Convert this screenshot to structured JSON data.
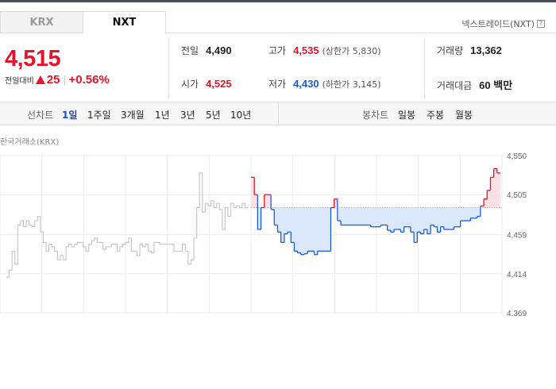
{
  "tabs": {
    "krx": "KRX",
    "nxt": "NXT"
  },
  "nxt_info": {
    "label": "넥스트레이드(NXT)",
    "help_icon": "?"
  },
  "price": {
    "current": "4,515",
    "change_label": "전일대비",
    "change_value": "25",
    "change_percent": "+0.56%",
    "direction_icon": "up-triangle-icon",
    "color": "#e5132b"
  },
  "stats": {
    "prev_close": {
      "label": "전일",
      "value": "4,490"
    },
    "high": {
      "label": "고가",
      "value": "4,535",
      "sub": "(상한가 5,830)"
    },
    "volume": {
      "label": "거래량",
      "value": "13,362"
    },
    "open": {
      "label": "시가",
      "value": "4,525"
    },
    "low": {
      "label": "저가",
      "value": "4,430",
      "sub": "(하한가 3,145)"
    },
    "amount": {
      "label": "거래대금",
      "value": "60 백만"
    }
  },
  "line_chart_menu": {
    "label": "선차트",
    "periods": [
      "1일",
      "1주일",
      "3개월",
      "1년",
      "3년",
      "5년",
      "10년"
    ],
    "active": "1일"
  },
  "candle_chart_menu": {
    "label": "봉차트",
    "periods": [
      "일봉",
      "주봉",
      "월봉"
    ]
  },
  "chart_data": {
    "type": "line",
    "title": "한국거래소(KRX)",
    "y_ticks": [
      "4,550",
      "4,505",
      "4,459",
      "4,414",
      "4,369"
    ],
    "ylim": [
      4369,
      4550
    ],
    "baseline": 4490,
    "colors": {
      "krx_line": "#c8c8c8",
      "up": "#e5132b",
      "down": "#1a5bd8",
      "down_fill": "#dbe8f9",
      "up_fill": "#fbe1e3"
    },
    "krx_series": [
      4410,
      4418,
      4440,
      4425,
      4470,
      4475,
      4468,
      4475,
      4470,
      4468,
      4475,
      4480,
      4462,
      4450,
      4440,
      4448,
      4445,
      4440,
      4430,
      4435,
      4430,
      4445,
      4448,
      4445,
      4448,
      4450,
      4450,
      4445,
      4440,
      4448,
      4452,
      4455,
      4450,
      4450,
      4442,
      4445,
      4445,
      4448,
      4448,
      4440,
      4445,
      4448,
      4450,
      4455,
      4440,
      4440,
      4435,
      4448,
      4445,
      4448,
      4440,
      4438,
      4450,
      4450,
      4448,
      4448,
      4448,
      4448,
      4448,
      4440,
      4440,
      4440,
      4448,
      4440,
      4425,
      4430,
      4455,
      4490,
      4530,
      4485,
      4495,
      4492,
      4498,
      4490,
      4495,
      4488,
      4465,
      4490,
      4480,
      4495,
      4490,
      4492,
      4490,
      4495,
      4490,
      4492
    ],
    "nxt_series": [
      4525,
      4505,
      4465,
      4490,
      4505,
      4505,
      4488,
      4470,
      4462,
      4450,
      4460,
      4462,
      4450,
      4440,
      4438,
      4436,
      4437,
      4440,
      4440,
      4436,
      4440,
      4440,
      4440,
      4440,
      4490,
      4500,
      4475,
      4470,
      4470,
      4470,
      4470,
      4470,
      4470,
      4470,
      4470,
      4470,
      4468,
      4468,
      4468,
      4470,
      4470,
      4464,
      4462,
      4465,
      4465,
      4462,
      4468,
      4468,
      4462,
      4450,
      4462,
      4460,
      4465,
      4460,
      4470,
      4468,
      4462,
      4468,
      4465,
      4465,
      4465,
      4468,
      4468,
      4475,
      4475,
      4475,
      4478,
      4478,
      4480,
      4492,
      4500,
      4510,
      4525,
      4535,
      4530,
      4530
    ]
  }
}
